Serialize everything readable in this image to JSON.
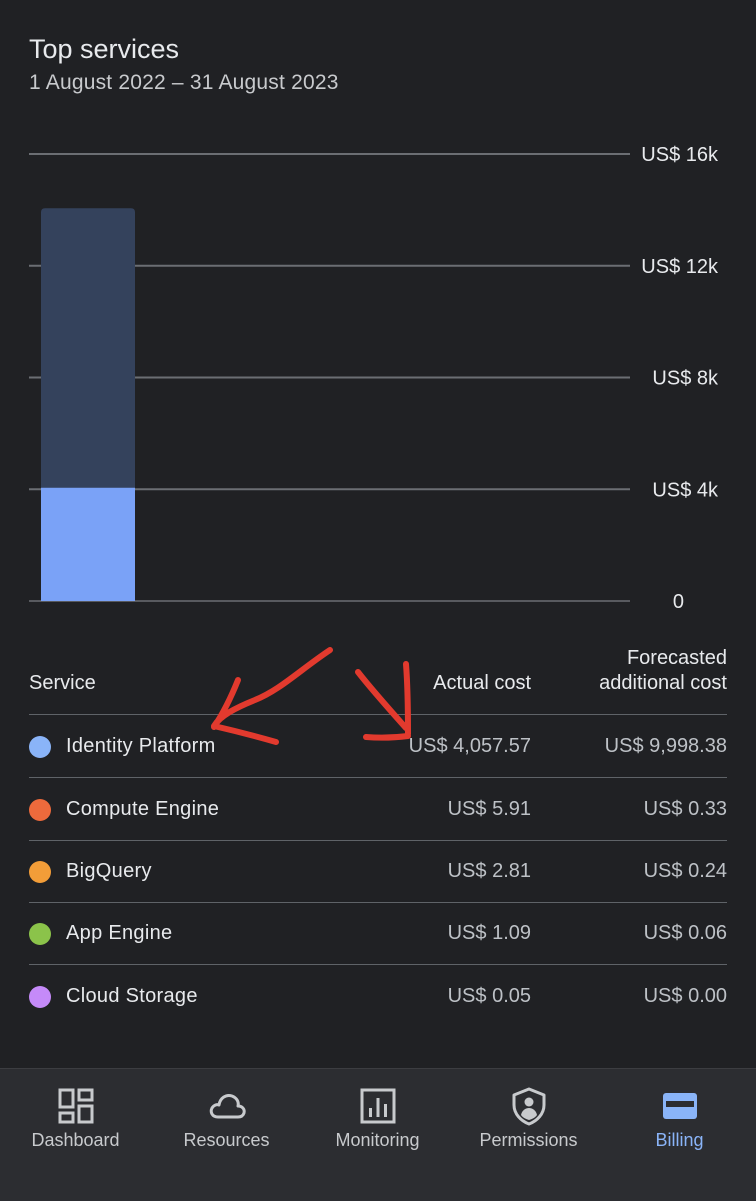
{
  "header": {
    "title": "Top services",
    "date_range": "1 August 2022 – 31 August 2023"
  },
  "chart_data": {
    "type": "bar",
    "categories": [
      ""
    ],
    "series": [
      {
        "values": [
          4057.57
        ],
        "color": "#7aa2f7"
      },
      {
        "values": [
          9998.38
        ],
        "color": "#34425c"
      }
    ],
    "stacked": true,
    "ylim": [
      0,
      16000
    ],
    "ytick_values": [
      0,
      4000,
      8000,
      12000,
      16000
    ],
    "ytick_labels": [
      "0",
      "US$ 4k",
      "US$ 8k",
      "US$ 12k",
      "US$ 16k"
    ],
    "grid": true
  },
  "table": {
    "headers": {
      "service": "Service",
      "actual": "Actual cost",
      "forecast_line1": "Forecasted",
      "forecast_line2": "additional cost"
    },
    "rows": [
      {
        "name": "Identity Platform",
        "actual": "US$ 4,057.57",
        "forecast": "US$ 9,998.38",
        "color": "#8ab4f8"
      },
      {
        "name": "Compute Engine",
        "actual": "US$ 5.91",
        "forecast": "US$ 0.33",
        "color": "#ee6a3c"
      },
      {
        "name": "BigQuery",
        "actual": "US$ 2.81",
        "forecast": "US$ 0.24",
        "color": "#f29d38"
      },
      {
        "name": "App Engine",
        "actual": "US$ 1.09",
        "forecast": "US$ 0.06",
        "color": "#8bc34a"
      },
      {
        "name": "Cloud Storage",
        "actual": "US$ 0.05",
        "forecast": "US$ 0.00",
        "color": "#c58af9"
      }
    ]
  },
  "annotation_color": "#e23a2e",
  "nav": {
    "items": [
      {
        "label": "Dashboard",
        "icon": "dashboard-icon",
        "active": false
      },
      {
        "label": "Resources",
        "icon": "cloud-icon",
        "active": false
      },
      {
        "label": "Monitoring",
        "icon": "monitoring-icon",
        "active": false
      },
      {
        "label": "Permissions",
        "icon": "shield-person-icon",
        "active": false
      },
      {
        "label": "Billing",
        "icon": "billing-card-icon",
        "active": true
      }
    ]
  }
}
